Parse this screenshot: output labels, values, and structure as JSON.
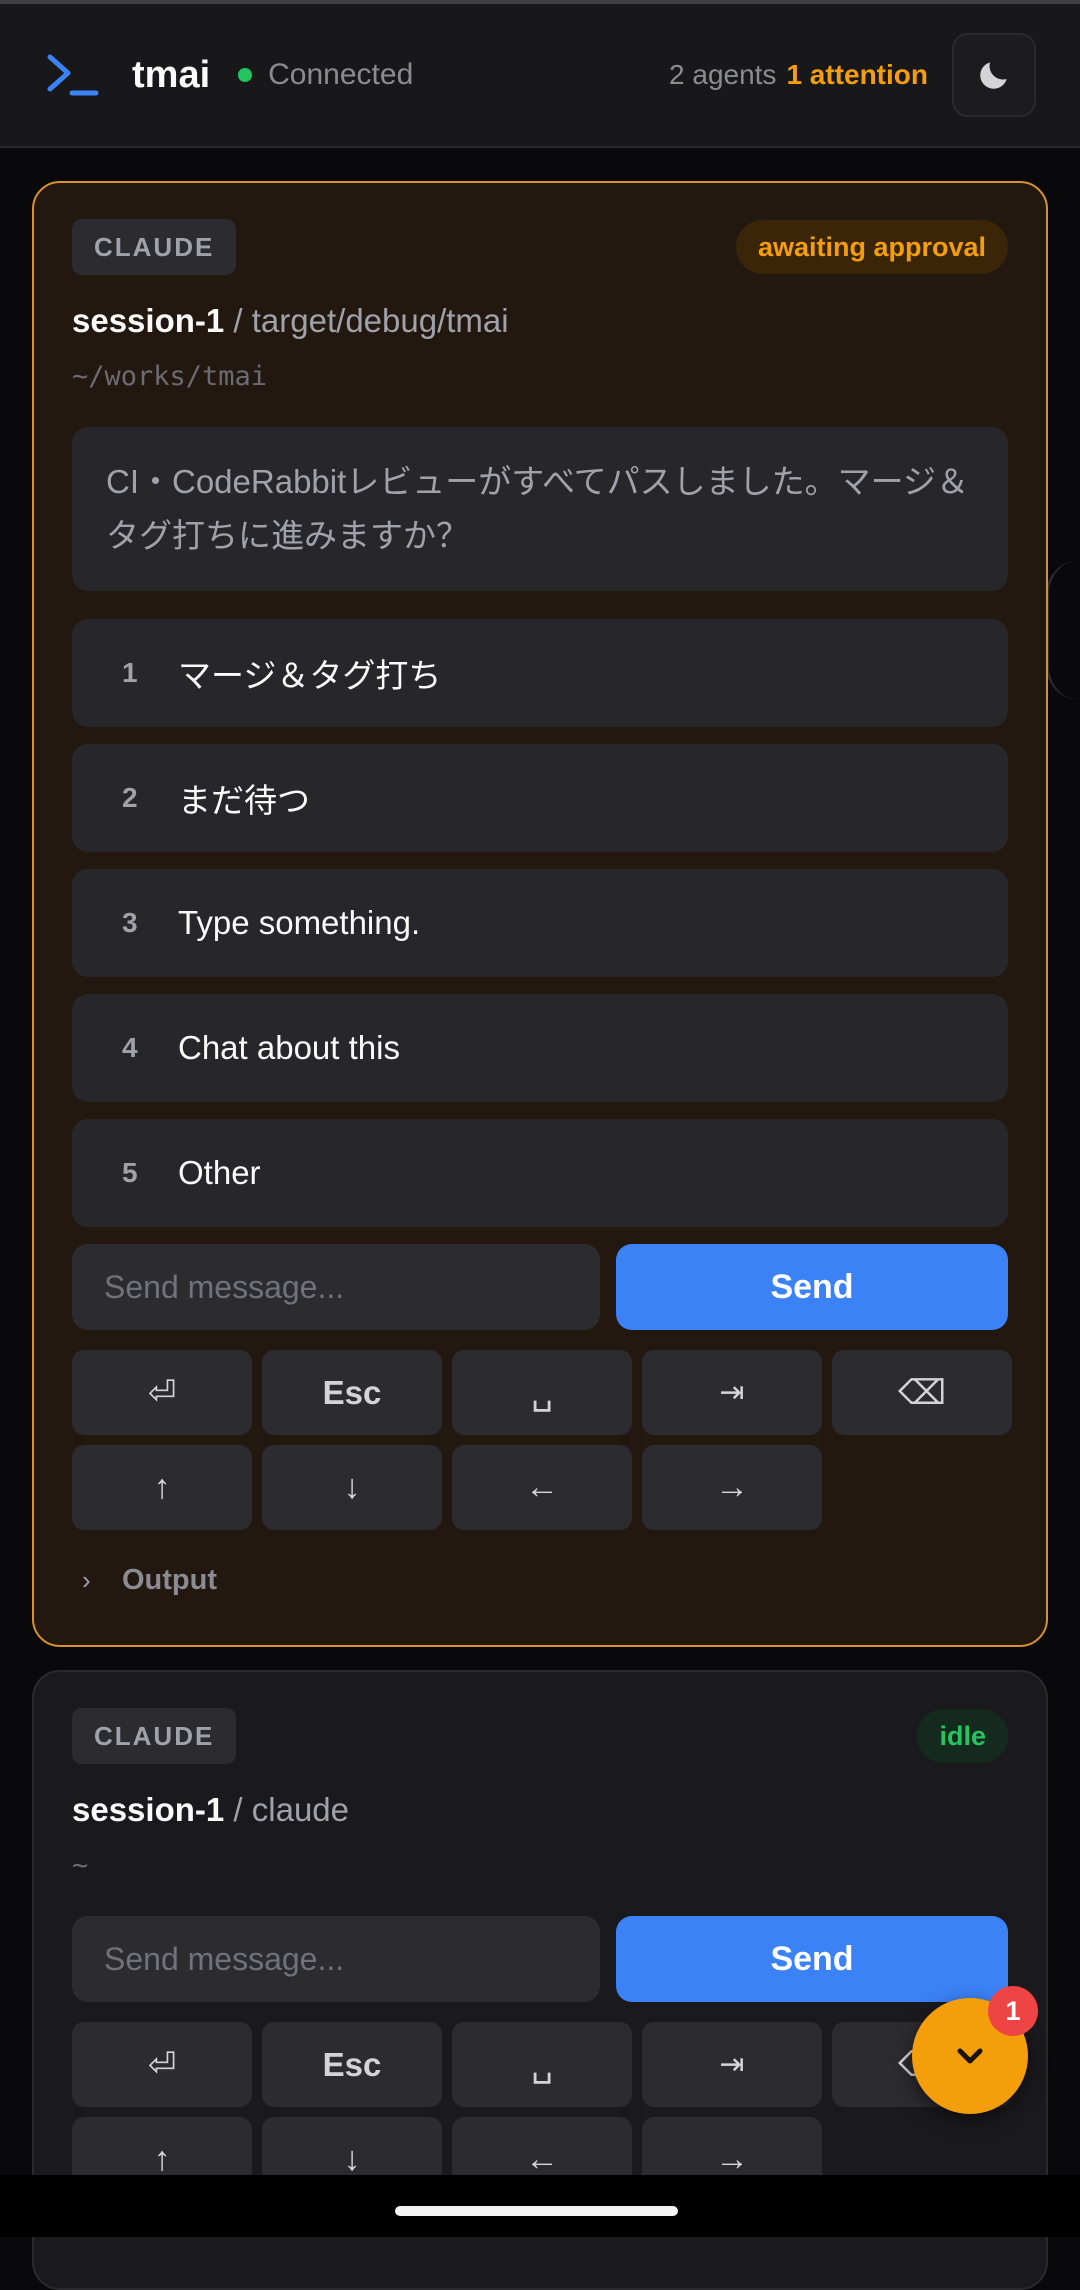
{
  "header": {
    "app_title": "tmai",
    "connection_status": "Connected",
    "agents_count": "2 agents",
    "attention_count": "1 attention",
    "colors": {
      "connected": "#22c55e",
      "attention": "#f59e0b",
      "logo": "#3b82f6"
    }
  },
  "cards": [
    {
      "agent_type": "CLAUDE",
      "status": "awaiting approval",
      "session_name": "session-1",
      "target": "/ target/debug/tmai",
      "path": "~/works/tmai",
      "prompt": "CI・CodeRabbitレビューがすべてパスしました。マージ＆タグ打ちに進みますか？",
      "options": [
        {
          "num": "1",
          "label": "マージ＆タグ打ち"
        },
        {
          "num": "2",
          "label": "まだ待つ"
        },
        {
          "num": "3",
          "label": "Type something."
        },
        {
          "num": "4",
          "label": "Chat about this"
        },
        {
          "num": "5",
          "label": "Other"
        }
      ],
      "input_placeholder": "Send message...",
      "send_label": "Send",
      "keys": [
        "⏎",
        "Esc",
        "␣",
        "⇥",
        "⌫",
        "↑",
        "↓",
        "←",
        "→"
      ],
      "output_label": "Output"
    },
    {
      "agent_type": "CLAUDE",
      "status": "idle",
      "session_name": "session-1",
      "target": "/ claude",
      "path": "~",
      "input_placeholder": "Send message...",
      "send_label": "Send",
      "keys": [
        "⏎",
        "Esc",
        "␣",
        "⇥",
        "⌫",
        "↑",
        "↓",
        "←",
        "→"
      ]
    }
  ],
  "fab": {
    "badge_count": "1",
    "icon": "chevron-down-icon"
  }
}
